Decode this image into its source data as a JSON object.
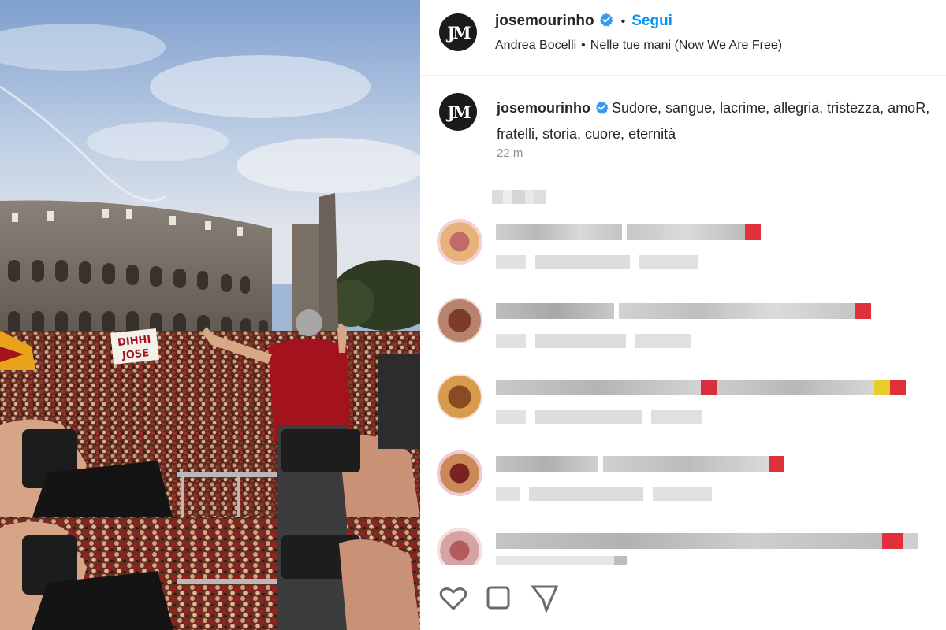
{
  "post": {
    "username": "josemourinho",
    "avatar_initials": "JM",
    "follow_label": "Segui",
    "audio": {
      "artist": "Andrea Bocelli",
      "track": "Nelle tue mani (Now We Are Free)"
    }
  },
  "photo": {
    "banner_text_1": "DIHHI",
    "banner_text_2": "JOSE"
  },
  "caption": {
    "username": "josemourinho",
    "text": "Sudore, sangue, lacrime, allegria, tristezza, amoR, fratelli, storia, cuore, eternità",
    "time": "22 m"
  },
  "colors": {
    "follow_blue": "#0095f6",
    "verified_blue": "#3897f0",
    "text_primary": "#262626",
    "text_secondary": "#8e8e8e",
    "roma_red": "#a4121e"
  },
  "icons": {
    "verified": "verified-badge-icon",
    "like": "heart-icon",
    "comment": "comment-icon",
    "share": "share-icon"
  }
}
